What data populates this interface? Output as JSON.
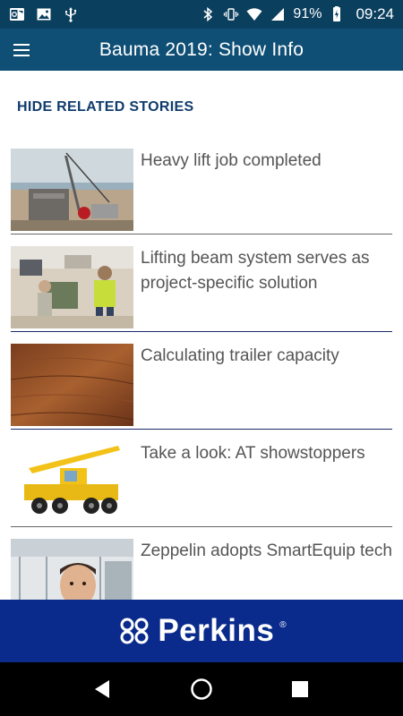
{
  "status_bar": {
    "battery": "91%",
    "time": "09:24",
    "left_icons": [
      "outlook-icon",
      "image-icon",
      "usb-icon"
    ],
    "right_icons": [
      "bluetooth-icon",
      "vibrate-icon",
      "wifi-icon",
      "signal-icon",
      "battery-icon"
    ]
  },
  "app_bar": {
    "title": "Bauma 2019: Show Info",
    "menu_icon": "hamburger-menu-icon",
    "background": "#0f4f75"
  },
  "related": {
    "toggle_label": "HIDE RELATED STORIES",
    "stories": [
      {
        "headline": "Heavy lift job completed",
        "divider_color": "#666666"
      },
      {
        "headline": "Lifting beam system serves as project-specific solution",
        "divider_color": "#1a2a6c"
      },
      {
        "headline": "Calculating trailer capacity",
        "divider_color": "#1a2a6c"
      },
      {
        "headline": "Take a look: AT showstoppers",
        "divider_color": "#666666"
      },
      {
        "headline": "Zeppelin adopts SmartEquip tech",
        "divider_color": "#666666"
      }
    ]
  },
  "ad": {
    "brand": "Perkins",
    "registered_mark": "®",
    "background": "#0a2b8c"
  },
  "nav_bar": {
    "buttons": [
      "back-icon",
      "home-icon",
      "recents-icon"
    ]
  }
}
